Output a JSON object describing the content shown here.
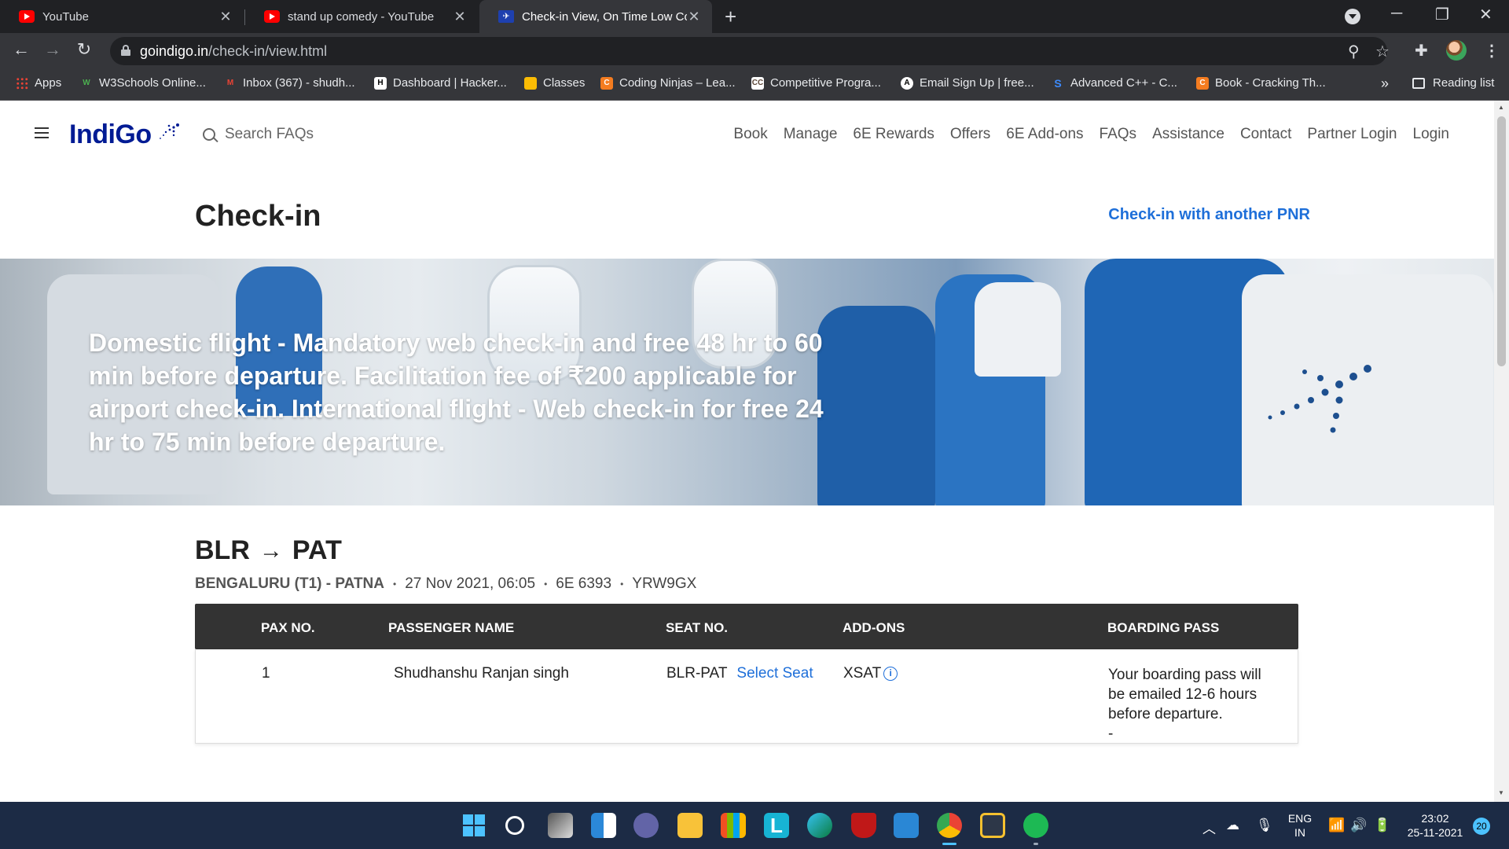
{
  "browser": {
    "tabs": [
      {
        "title": "YouTube",
        "favicon": "youtube-icon",
        "active": false
      },
      {
        "title": "stand up comedy - YouTube",
        "favicon": "youtube-icon",
        "active": false
      },
      {
        "title": "Check-in View, On Time Low Cos",
        "favicon": "indigo-icon",
        "active": true
      }
    ],
    "new_tab": "+",
    "url_host": "goindigo.in",
    "url_path": "/check-in/view.html",
    "bookmarks": [
      {
        "label": "Apps",
        "icon": "apps-grid-icon"
      },
      {
        "label": "W3Schools Online...",
        "icon": "w3schools-icon"
      },
      {
        "label": "Inbox (367) - shudh...",
        "icon": "gmail-icon"
      },
      {
        "label": "Dashboard | Hacker...",
        "icon": "hackerrank-icon"
      },
      {
        "label": "Classes",
        "icon": "classroom-icon"
      },
      {
        "label": "Coding Ninjas – Lea...",
        "icon": "coding-ninjas-icon"
      },
      {
        "label": "Competitive Progra...",
        "icon": "codechef-icon"
      },
      {
        "label": "Email Sign Up | free...",
        "icon": "email-icon"
      },
      {
        "label": "Advanced C++ - C...",
        "icon": "s-icon"
      },
      {
        "label": "Book - Cracking Th...",
        "icon": "book-icon"
      }
    ],
    "bookmarks_more": "»",
    "reading_list": "Reading list"
  },
  "site": {
    "logo": "IndiGo",
    "search_placeholder": "Search FAQs",
    "nav": [
      "Book",
      "Manage",
      "6E Rewards",
      "Offers",
      "6E Add-ons",
      "FAQs",
      "Assistance",
      "Contact",
      "Partner Login",
      "Login"
    ]
  },
  "checkin": {
    "title": "Check-in",
    "another_pnr": "Check-in with another PNR",
    "banner_text": "Domestic flight - Mandatory web check-in and free 48 hr to 60 min before departure. Facilitation fee of ₹200 applicable for airport check-in. International flight - Web check-in for free 24 hr to 75 min before departure.",
    "route": {
      "from": "BLR",
      "arrow": "→",
      "to": "PAT"
    },
    "meta": {
      "sector": "BENGALURU (T1) - PATNA",
      "datetime": "27 Nov 2021, 06:05",
      "flight_no": "6E 6393",
      "pnr": "YRW9GX",
      "separator": "•"
    },
    "table": {
      "headers": [
        "PAX NO.",
        "PASSENGER NAME",
        "SEAT NO.",
        "ADD-ONS",
        "BOARDING PASS"
      ],
      "rows": [
        {
          "pax_no": "1",
          "name": "Shudhanshu Ranjan singh",
          "seat_sector": "BLR-PAT",
          "seat_action": "Select Seat",
          "addon": "XSAT",
          "boarding_pass": "Your boarding pass will be emailed 12-6 hours before departure.",
          "boarding_extra": "-"
        }
      ]
    }
  },
  "taskbar": {
    "lang_line1": "ENG",
    "lang_line2": "IN",
    "time": "23:02",
    "date": "25-11-2021",
    "notifications": "20"
  },
  "colors": {
    "brand": "#001b94",
    "link": "#1e6fd9",
    "table_header": "#333333"
  }
}
